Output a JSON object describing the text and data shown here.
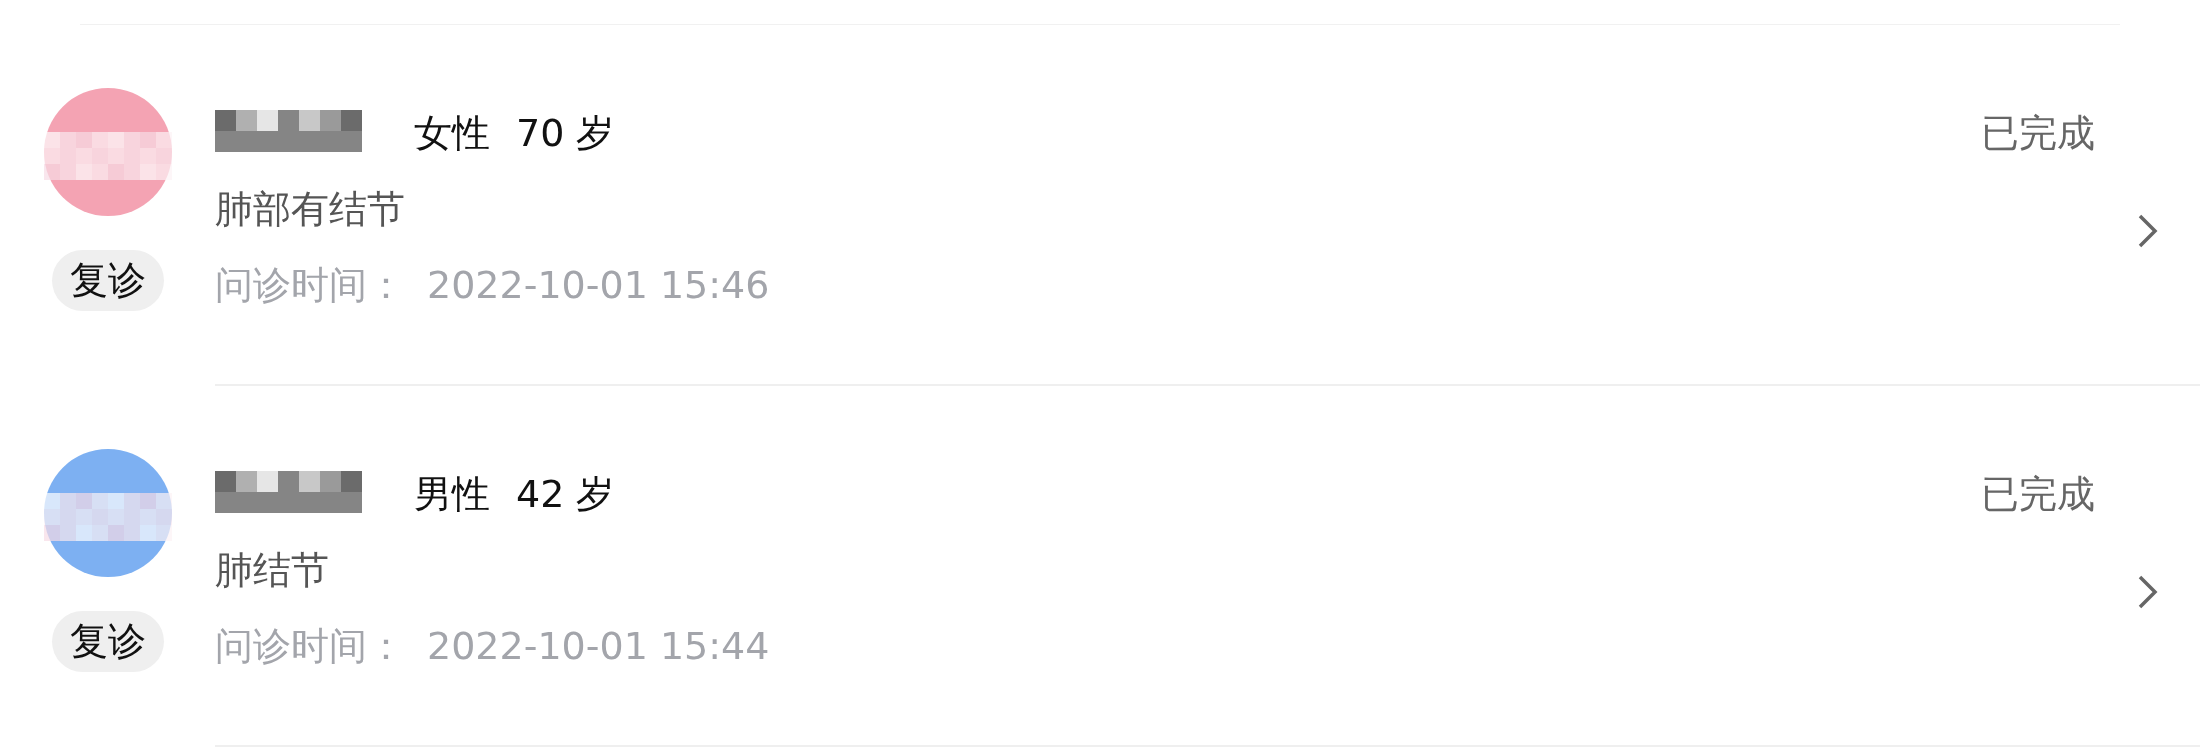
{
  "consultations": [
    {
      "avatar": {
        "color": "#f4a3b3"
      },
      "gender": "女性",
      "age": "70 岁",
      "diagnosis": "肺部有结节",
      "visit_type": "复诊",
      "time_label": "问诊时间：",
      "time": "2022-10-01 15:46",
      "status": "已完成"
    },
    {
      "avatar": {
        "color": "#7db0f2"
      },
      "gender": "男性",
      "age": "42 岁",
      "diagnosis": "肺结节",
      "visit_type": "复诊",
      "time_label": "问诊时间：",
      "time": "2022-10-01 15:44",
      "status": "已完成"
    }
  ]
}
